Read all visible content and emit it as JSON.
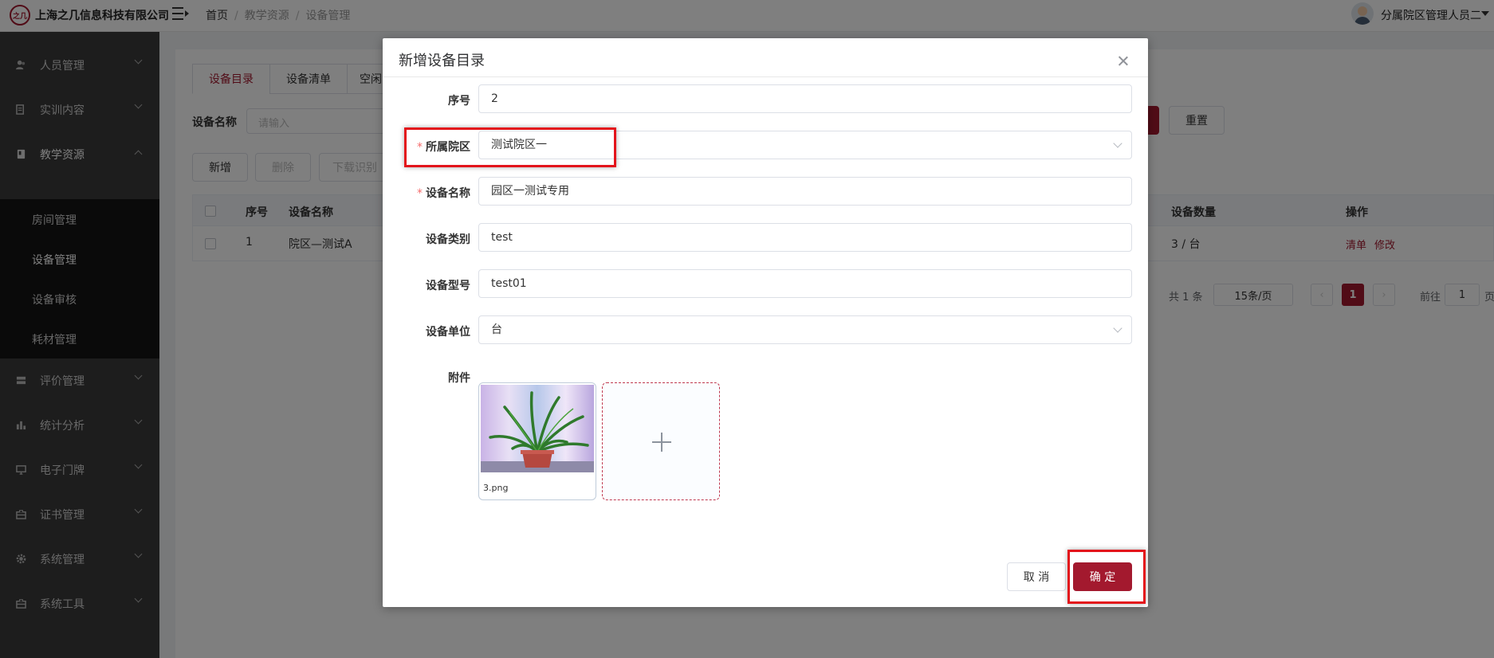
{
  "header": {
    "logo_text": "之几",
    "company": "上海之几信息科技有限公司",
    "breadcrumb": [
      "首页",
      "教学资源",
      "设备管理"
    ],
    "username": "分属院区管理人员二"
  },
  "sidebar": {
    "items": [
      {
        "label": "人员管理",
        "icon": "users-icon"
      },
      {
        "label": "实训内容",
        "icon": "document-icon"
      },
      {
        "label": "教学资源",
        "icon": "book-icon"
      },
      {
        "label": "评价管理",
        "icon": "list-icon"
      },
      {
        "label": "统计分析",
        "icon": "bar-chart-icon"
      },
      {
        "label": "电子门牌",
        "icon": "monitor-icon"
      },
      {
        "label": "证书管理",
        "icon": "briefcase-icon"
      },
      {
        "label": "系统管理",
        "icon": "gear-icon"
      },
      {
        "label": "系统工具",
        "icon": "toolbox-icon"
      }
    ],
    "subitems": [
      "房间管理",
      "设备管理",
      "设备审核",
      "耗材管理"
    ]
  },
  "page": {
    "tabs": [
      "设备目录",
      "设备清单",
      "空闲"
    ],
    "search_label": "设备名称",
    "search_placeholder": "请输入",
    "reset": "重置",
    "toolbar": {
      "add": "新增",
      "delete": "删除",
      "download": "下载识别"
    },
    "table": {
      "headers": {
        "no": "序号",
        "name": "设备名称",
        "count": "设备数量",
        "action": "操作"
      },
      "rows": [
        {
          "no": "1",
          "name": "院区—测试A",
          "count": "3 / 台",
          "action_list": "清单",
          "action_edit": "修改"
        }
      ]
    },
    "pager": {
      "total": "共 1 条",
      "size": "15条/页",
      "current": "1",
      "goto": "前往",
      "goto_value": "1",
      "page_suffix": "页"
    }
  },
  "dialog": {
    "title": "新增设备目录",
    "fields": {
      "index": {
        "label": "序号",
        "value": "2"
      },
      "campus": {
        "label": "所属院区",
        "value": "测试院区一"
      },
      "name": {
        "label": "设备名称",
        "value": "园区一测试专用"
      },
      "category": {
        "label": "设备类别",
        "value": "test"
      },
      "model": {
        "label": "设备型号",
        "value": "test01"
      },
      "unit": {
        "label": "设备单位",
        "value": "台"
      },
      "attachment": {
        "label": "附件",
        "file": "3.png"
      }
    },
    "cancel": "取 消",
    "confirm": "确 定"
  },
  "colors": {
    "brand": "#a3192e",
    "highlight": "#e3141b",
    "sidebar": "#3a3a3a"
  }
}
